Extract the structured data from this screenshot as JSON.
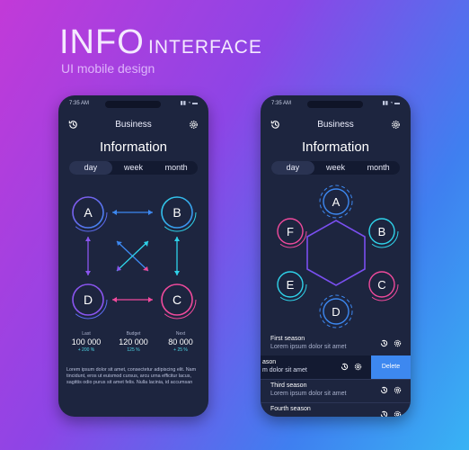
{
  "hero": {
    "title": "INFO",
    "subtitle": "INTERFACE",
    "caption": "UI mobile design"
  },
  "status_time": "7:35 AM",
  "status_icons": "▮▮ ◔ ▬",
  "phone1": {
    "title": "Business",
    "heading": "Information",
    "tabs": [
      "day",
      "week",
      "month"
    ],
    "active_tab": "day",
    "nodes": [
      "A",
      "B",
      "C",
      "D"
    ],
    "stats": [
      {
        "label": "Last",
        "value": "100 000",
        "change": "+ 200 %"
      },
      {
        "label": "Budget",
        "value": "120 000",
        "change": "125 %"
      },
      {
        "label": "Next",
        "value": "80 000",
        "change": "+ 25 %"
      }
    ],
    "lorem": "Lorem ipsum dolor sit amet, consectetur adipiscing elit. Nam tincidunt, eros ut euismod cursus, arcu urna efficitur lacus, sagittis odio purus sit amet felis. Nulla lacinia, id accumsan"
  },
  "phone2": {
    "title": "Business",
    "heading": "Information",
    "tabs": [
      "day",
      "week",
      "month"
    ],
    "active_tab": "day",
    "nodes": [
      "A",
      "B",
      "C",
      "D",
      "E",
      "F"
    ],
    "seasons": [
      {
        "title": "First season",
        "subtitle": "Lorem ipsum dolor sit amet"
      },
      {
        "title": "ason",
        "subtitle": "m dolor sit amet"
      },
      {
        "title": "Third season",
        "subtitle": "Lorem ipsum dolor sit amet"
      },
      {
        "title": "Fourth season",
        "subtitle": ""
      }
    ],
    "delete_label": "Delete"
  },
  "colors": {
    "bg_dark": "#1d253f",
    "cyan": "#2fd3ea",
    "pink": "#f04a9c",
    "purple": "#8a55ef",
    "blue": "#3d88f0"
  }
}
